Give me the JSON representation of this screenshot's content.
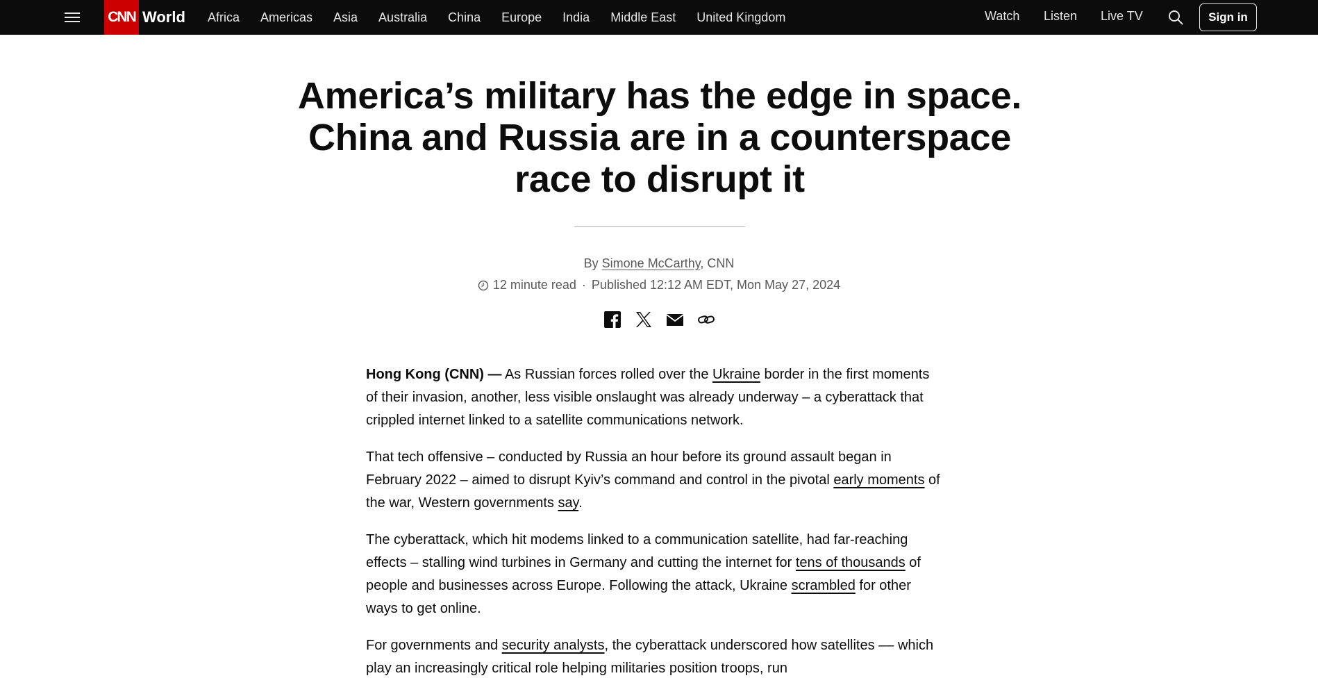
{
  "nav": {
    "logo": "CNN",
    "section": "World",
    "links": [
      "Africa",
      "Americas",
      "Asia",
      "Australia",
      "China",
      "Europe",
      "India",
      "Middle East",
      "United Kingdom"
    ],
    "watch": "Watch",
    "listen": "Listen",
    "live_tv": "Live TV",
    "sign_in": "Sign in"
  },
  "headline": {
    "line1": "America’s military has the edge in space.",
    "line2": "China and Russia are in a counterspace",
    "line3": "race to disrupt it"
  },
  "byline": {
    "prefix": "By",
    "author": "Simone McCarthy",
    "outlet": ", CNN"
  },
  "meta": {
    "read_time": "12 minute read",
    "separator": "·",
    "published": "Published 12:12 AM EDT, Mon May 27, 2024"
  },
  "article": {
    "p1": {
      "dateline": "Hong Kong (CNN) —",
      "t1": " As Russian forces rolled over the ",
      "l1": "Ukraine",
      "t2": " border in the first moments of their invasion, another, less visible onslaught was already underway – a cyberattack that crippled internet linked to a satellite communications network."
    },
    "p2": {
      "t1": "That tech offensive – conducted by Russia an hour before its ground assault began in February 2022 – aimed to disrupt Kyiv’s command and control in the pivotal ",
      "l1": "early moments",
      "t2": " of the war, Western governments ",
      "l2": "say",
      "t3": "."
    },
    "p3": {
      "t1": "The cyberattack, which hit modems linked to a communication satellite, had far-reaching effects – stalling wind turbines in Germany and cutting the internet for ",
      "l1": "tens of thousands",
      "t2": " of people and businesses across Europe. Following the attack, Ukraine ",
      "l2": "scrambled",
      "t3": " for other ways to get online."
    },
    "p4": {
      "t1": "For governments and ",
      "l1": "security analysts",
      "t2": ", the cyberattack underscored how satellites –– which play an increasingly critical role helping militaries position troops, run"
    }
  },
  "icons": {
    "menu": "hamburger-icon",
    "search": "search-icon",
    "clock": "clock-icon",
    "facebook": "facebook-icon",
    "x": "x-icon",
    "email": "email-icon",
    "link": "link-icon"
  },
  "colors": {
    "nav_bg": "#0c0c0c",
    "brand_red": "#cc0000",
    "text": "#0c0c0c",
    "meta_text": "#595959"
  }
}
